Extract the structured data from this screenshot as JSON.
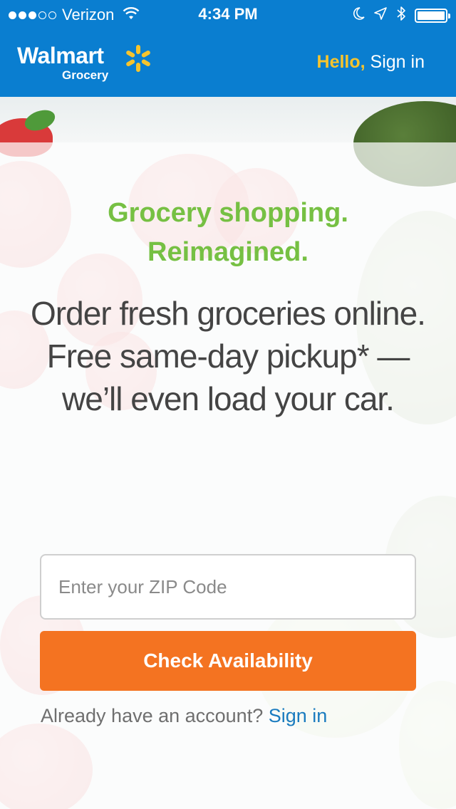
{
  "status_bar": {
    "carrier": "Verizon",
    "time": "4:34 PM",
    "signal": {
      "filled_dots": 3,
      "total_dots": 5
    },
    "battery_level": 1.0
  },
  "header": {
    "logo_main": "Walmart",
    "logo_sub": "Grocery",
    "greeting_word": "Hello,",
    "sign_in_label": "Sign in",
    "brand_color": "#0a7ed0",
    "spark_color": "#f6c42d"
  },
  "hero": {
    "tagline_line1": "Grocery shopping.",
    "tagline_line2": "Reimagined.",
    "description": "Order fresh groceries online. Free same-day pickup* — we’ll even load your car."
  },
  "zip": {
    "placeholder": "Enter your ZIP Code",
    "value": ""
  },
  "actions": {
    "check_label": "Check Availability",
    "account_prompt": "Already have an account?",
    "account_sign_in": "Sign in",
    "accent_color": "#f47321"
  }
}
